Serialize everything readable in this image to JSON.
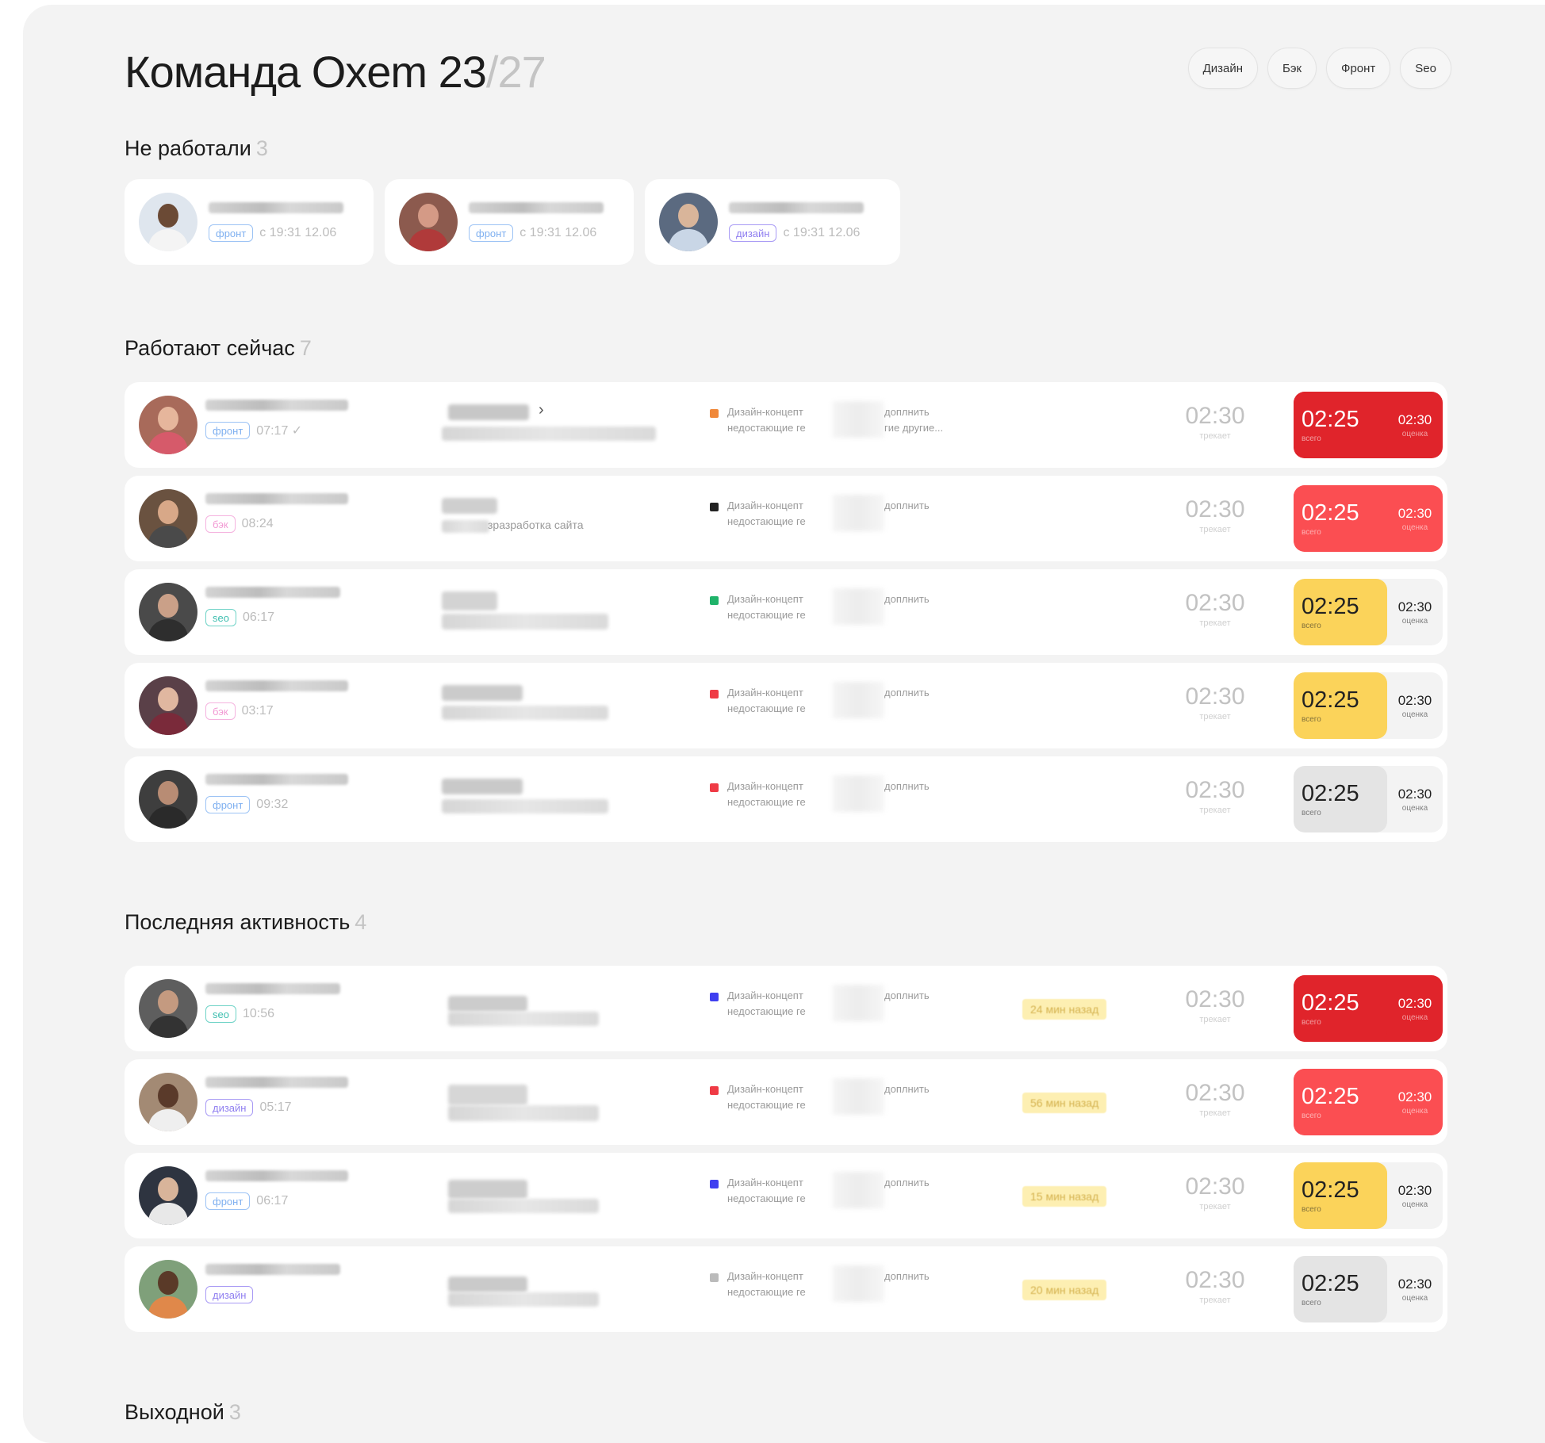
{
  "header": {
    "title": "Команда Oxem 23",
    "count": "/27",
    "filters": [
      "Дизайн",
      "Бэк",
      "Фронт",
      "Seo"
    ]
  },
  "sections": {
    "idle": {
      "title": "Не работали",
      "count": "3"
    },
    "working": {
      "title": "Работают сейчас",
      "count": "7"
    },
    "recent": {
      "title": "Последняя активность",
      "count": "4"
    },
    "dayoff": {
      "title": "Выходной",
      "count": "3"
    }
  },
  "idle_people": [
    {
      "tag": "фронт",
      "since": "с 19:31 12.06"
    },
    {
      "tag": "фронт",
      "since": "с 19:31 12.06"
    },
    {
      "tag": "дизайн",
      "since": "с 19:31 12.06"
    }
  ],
  "labels": {
    "today": "трекает",
    "total": "всего",
    "estimate": "оценка"
  },
  "working_rows": [
    {
      "tag": "фронт",
      "time": "07:17 ✓",
      "task_sub": "",
      "dot_color": "#f0883a",
      "note1": "Дизайн-концепт",
      "note2": "недостающие ге",
      "note3": "доплнить",
      "note4": "гие другие...",
      "today": "02:30",
      "total": "02:25",
      "estimate": "02:30",
      "status": "darkred"
    },
    {
      "tag": "бэк",
      "time": "08:24",
      "task_sub": "зразработка сайта",
      "dot_color": "#222222",
      "note1": "Дизайн-концепт",
      "note2": "недостающие ге",
      "note3": "доплнить",
      "note4": "",
      "today": "02:30",
      "total": "02:25",
      "estimate": "02:30",
      "status": "red"
    },
    {
      "tag": "seo",
      "time": "06:17",
      "task_sub": "",
      "dot_color": "#1fb36a",
      "note1": "Дизайн-концепт",
      "note2": "недостающие ге",
      "note3": "доплнить",
      "note4": "",
      "today": "02:30",
      "total": "02:25",
      "estimate": "02:30",
      "status": "yellow"
    },
    {
      "tag": "бэк",
      "time": "03:17",
      "task_sub": "",
      "dot_color": "#ef3b45",
      "note1": "Дизайн-концепт",
      "note2": "недостающие ге",
      "note3": "доплнить",
      "note4": "",
      "today": "02:30",
      "total": "02:25",
      "estimate": "02:30",
      "status": "yellow"
    },
    {
      "tag": "фронт",
      "time": "09:32",
      "task_sub": "",
      "dot_color": "#ef3b45",
      "note1": "Дизайн-концепт",
      "note2": "недостающие ге",
      "note3": "доплнить",
      "note4": "",
      "today": "02:30",
      "total": "02:25",
      "estimate": "02:30",
      "status": "gray"
    }
  ],
  "recent_rows": [
    {
      "tag": "seo",
      "time": "10:56",
      "dot_color": "#3f3ff0",
      "note1": "Дизайн-концепт",
      "note2": "недостающие ге",
      "note3": "доплнить",
      "ago": "24 мин назад",
      "today": "02:30",
      "total": "02:25",
      "estimate": "02:30",
      "status": "darkred"
    },
    {
      "tag": "дизайн",
      "time": "05:17",
      "dot_color": "#ef3b45",
      "note1": "Дизайн-концепт",
      "note2": "недостающие ге",
      "note3": "доплнить",
      "ago": "56 мин назад",
      "today": "02:30",
      "total": "02:25",
      "estimate": "02:30",
      "status": "red"
    },
    {
      "tag": "фронт",
      "time": "06:17",
      "dot_color": "#3f3ff0",
      "note1": "Дизайн-концепт",
      "note2": "недостающие ге",
      "note3": "доплнить",
      "ago": "15 мин назад",
      "today": "02:30",
      "total": "02:25",
      "estimate": "02:30",
      "status": "yellow"
    },
    {
      "tag": "дизайн",
      "time": "",
      "dot_color": "#bbbbbb",
      "note1": "Дизайн-концепт",
      "note2": "недостающие ге",
      "note3": "доплнить",
      "ago": "20 мин назад",
      "today": "02:30",
      "total": "02:25",
      "estimate": "02:30",
      "status": "gray"
    }
  ],
  "colors": {
    "panel_bg": "#f3f3f3",
    "timer_darkred": "#e0242b",
    "timer_red": "#fb4e52",
    "timer_yellow": "#fbd35a",
    "timer_gray": "#e4e4e4"
  }
}
